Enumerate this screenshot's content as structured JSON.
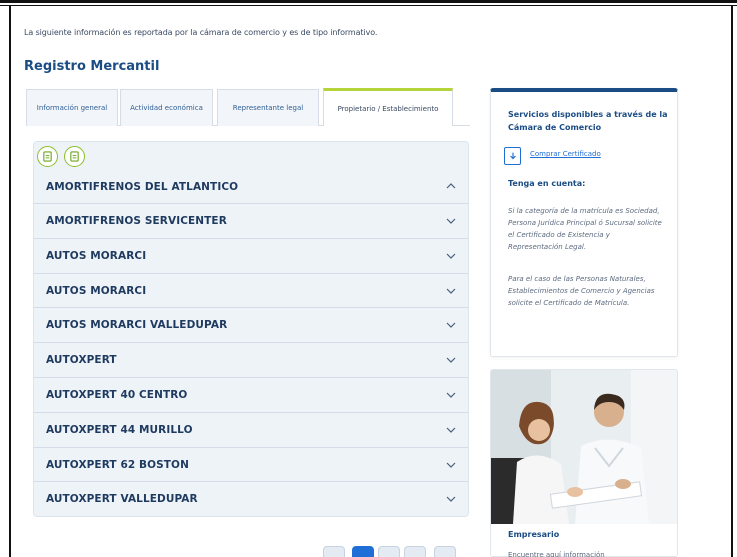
{
  "intro_text": "La siguiente información es reportada por la cámara de comercio y es de tipo informativo.",
  "section_title": "Registro Mercantil",
  "tabs": [
    {
      "label": "Información general"
    },
    {
      "label": "Actividad económica"
    },
    {
      "label": "Representante legal"
    },
    {
      "label": "Propietario / Establecimiento"
    }
  ],
  "active_tab": "Propietario / Establecimiento",
  "download_buttons": [
    {
      "icon": "document-download-icon"
    },
    {
      "icon": "document-download-icon"
    }
  ],
  "accordion": [
    {
      "name": "AMORTIFRENOS DEL ATLANTICO",
      "expanded": true
    },
    {
      "name": "AMORTIFRENOS SERVICENTER",
      "expanded": false
    },
    {
      "name": "AUTOS MORARCI",
      "expanded": false
    },
    {
      "name": "AUTOS MORARCI",
      "expanded": false
    },
    {
      "name": "AUTOS MORARCI VALLEDUPAR",
      "expanded": false
    },
    {
      "name": "AUTOXPERT",
      "expanded": false
    },
    {
      "name": "AUTOXPERT 40 CENTRO",
      "expanded": false
    },
    {
      "name": "AUTOXPERT 44 MURILLO",
      "expanded": false
    },
    {
      "name": "AUTOXPERT 62 BOSTON",
      "expanded": false
    },
    {
      "name": "AUTOXPERT VALLEDUPAR",
      "expanded": false
    }
  ],
  "pagination": {
    "active_page_index": 1
  },
  "sidebar": {
    "title": "Servicios disponibles a través de la Cámara de Comercio",
    "certificate_link": "Comprar Certificado",
    "certificate_icon": "download-icon",
    "note_title": "Tenga en cuenta:",
    "note_1": "Si la categoría de la matrícula es Sociedad, Persona Jurídica Principal ó Sucursal solicite el Certificado de Existencia y Representación Legal.",
    "note_2": "Para el caso de las Personas Naturales, Establecimientos de Comercio y Agencias solicite el Certificado de Matrícula."
  },
  "promo": {
    "caption": "Empresario",
    "subtitle": "Encuentre aquí información"
  },
  "colors": {
    "accent": "#1b4d84",
    "link": "#1f6fd6",
    "tab_active": "#b5d43a"
  }
}
